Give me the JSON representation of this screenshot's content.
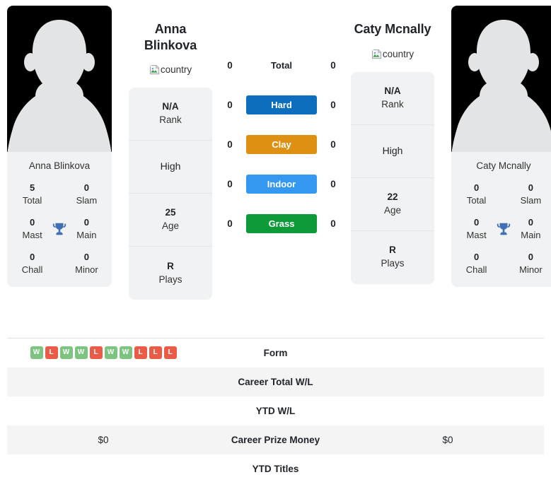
{
  "colors": {
    "hard": "#0d6ebd",
    "clay": "#dd9011",
    "indoor": "#3498f0",
    "grass": "#0d9b3a",
    "win": "#7cc47f",
    "loss": "#ea5b48",
    "card_bg": "#f1f2f3",
    "stripe": "#f4f4f5",
    "trophy": "#3f6fb5"
  },
  "players": {
    "left": {
      "full_name": "Anna Blinkova",
      "name_line1": "Anna",
      "name_line2": "Blinkova",
      "card_name": "Anna Blinkova",
      "country_alt": "country",
      "avatar_alt": "player-silhouette",
      "titles": [
        {
          "num": "5",
          "label": "Total"
        },
        {
          "num": "0",
          "label": "Slam"
        },
        {
          "num": "0",
          "label": "Mast"
        },
        {
          "num": "0",
          "label": "Main"
        },
        {
          "num": "0",
          "label": "Chall"
        },
        {
          "num": "0",
          "label": "Minor"
        }
      ],
      "info": [
        {
          "value": "N/A",
          "caption": "Rank",
          "bold": true
        },
        {
          "value": "High",
          "caption": "",
          "bold": false
        },
        {
          "value": "25",
          "caption": "Age",
          "bold": true
        },
        {
          "value": "R",
          "caption": "Plays",
          "bold": true
        }
      ],
      "surface_scores": {
        "total": "0",
        "hard": "0",
        "clay": "0",
        "indoor": "0",
        "grass": "0"
      },
      "form": [
        "W",
        "L",
        "W",
        "W",
        "L",
        "W",
        "W",
        "L",
        "L",
        "L"
      ],
      "career_total_wl": "",
      "ytd_wl": "",
      "career_prize_money": "$0",
      "ytd_titles": ""
    },
    "right": {
      "full_name": "Caty Mcnally",
      "name_line1": "Caty Mcnally",
      "name_line2": "",
      "card_name": "Caty Mcnally",
      "country_alt": "country",
      "avatar_alt": "player-silhouette",
      "titles": [
        {
          "num": "0",
          "label": "Total"
        },
        {
          "num": "0",
          "label": "Slam"
        },
        {
          "num": "0",
          "label": "Mast"
        },
        {
          "num": "0",
          "label": "Main"
        },
        {
          "num": "0",
          "label": "Chall"
        },
        {
          "num": "0",
          "label": "Minor"
        }
      ],
      "info": [
        {
          "value": "N/A",
          "caption": "Rank",
          "bold": true
        },
        {
          "value": "High",
          "caption": "",
          "bold": false
        },
        {
          "value": "22",
          "caption": "Age",
          "bold": true
        },
        {
          "value": "R",
          "caption": "Plays",
          "bold": true
        }
      ],
      "surface_scores": {
        "total": "0",
        "hard": "0",
        "clay": "0",
        "indoor": "0",
        "grass": "0"
      },
      "form": [],
      "career_total_wl": "",
      "ytd_wl": "",
      "career_prize_money": "$0",
      "ytd_titles": ""
    }
  },
  "surfaces": [
    {
      "key": "total",
      "label": "Total",
      "style": "plain"
    },
    {
      "key": "hard",
      "label": "Hard",
      "style": "tinted"
    },
    {
      "key": "clay",
      "label": "Clay",
      "style": "tinted"
    },
    {
      "key": "indoor",
      "label": "Indoor",
      "style": "tinted"
    },
    {
      "key": "grass",
      "label": "Grass",
      "style": "tinted"
    }
  ],
  "table": {
    "rows": [
      {
        "label": "Form"
      },
      {
        "label": "Career Total W/L"
      },
      {
        "label": "YTD W/L"
      },
      {
        "label": "Career Prize Money"
      },
      {
        "label": "YTD Titles"
      }
    ]
  }
}
